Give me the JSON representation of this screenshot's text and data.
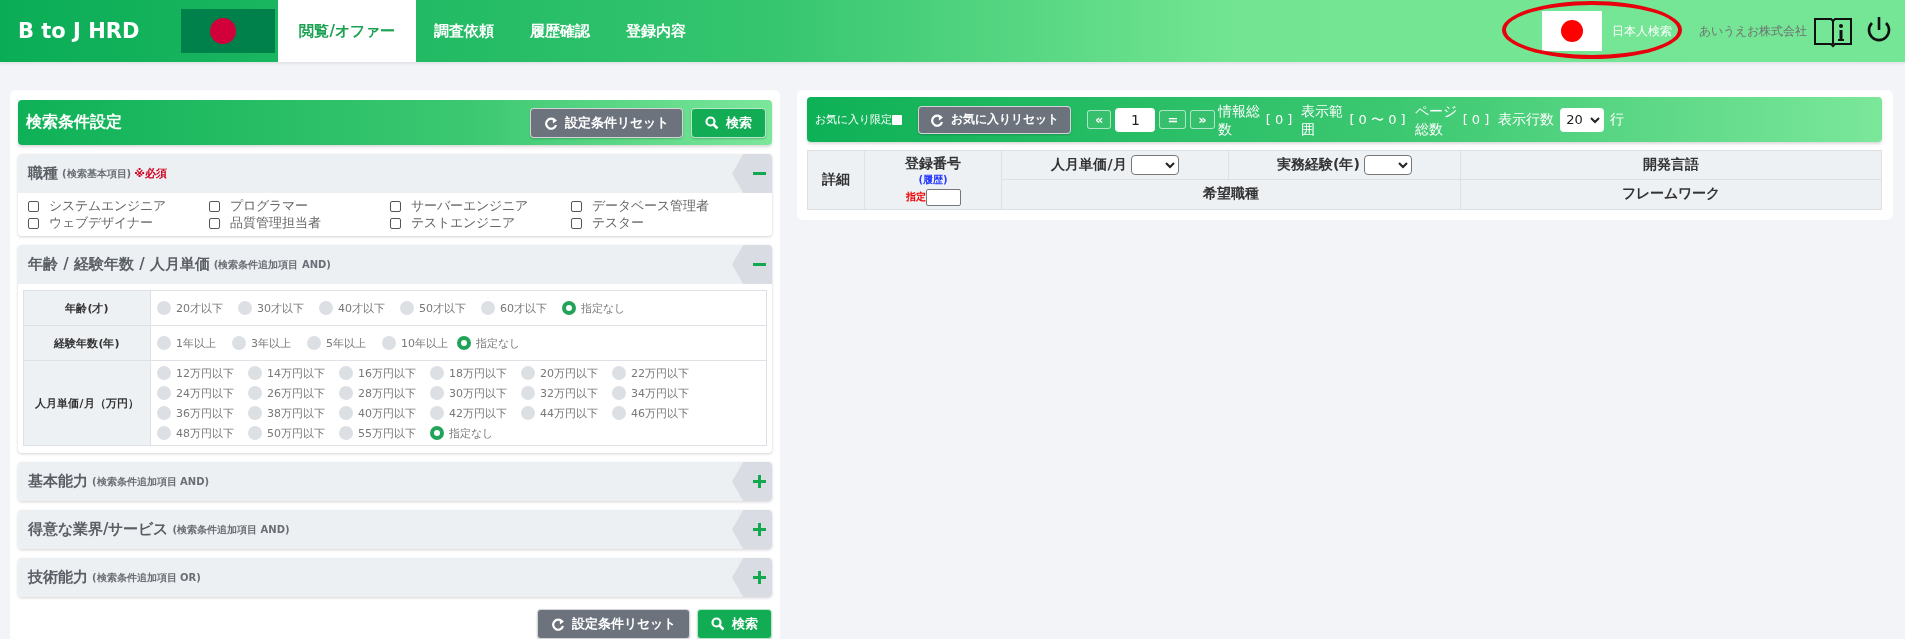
{
  "header": {
    "logo": "B to J HRD",
    "nav": [
      {
        "label": "閲覧/オファー",
        "selected": true
      },
      {
        "label": "調査依頼",
        "selected": false
      },
      {
        "label": "履歴確認",
        "selected": false
      },
      {
        "label": "登録内容",
        "selected": false
      }
    ],
    "japan_search": "日本人検索",
    "company": "あいうえお株式会社"
  },
  "search_panel": {
    "title": "検索条件設定",
    "reset_button": "設定条件リセット",
    "search_button": "検索",
    "sections": [
      {
        "kind": "checkboxes",
        "title": "職種",
        "note": "(検索基本項目)",
        "required": "※必須",
        "expanded": true,
        "options": [
          {
            "label": "システムエンジニア",
            "checked": false
          },
          {
            "label": "プログラマー",
            "checked": false
          },
          {
            "label": "サーバーエンジニア",
            "checked": false
          },
          {
            "label": "データベース管理者",
            "checked": false
          },
          {
            "label": "ウェブデザイナー",
            "checked": false
          },
          {
            "label": "品質管理担当者",
            "checked": false
          },
          {
            "label": "テストエンジニア",
            "checked": false
          },
          {
            "label": "テスター",
            "checked": false
          }
        ]
      },
      {
        "kind": "radio_table",
        "title": "年齢 / 経験年数 / 人月単価",
        "note": "(検索条件追加項目 AND)",
        "expanded": true,
        "rows": [
          {
            "label": "年齢(才)",
            "options": [
              {
                "label": "20才以下",
                "selected": false
              },
              {
                "label": "30才以下",
                "selected": false
              },
              {
                "label": "40才以下",
                "selected": false
              },
              {
                "label": "50才以下",
                "selected": false
              },
              {
                "label": "60才以下",
                "selected": false
              },
              {
                "label": "指定なし",
                "selected": true
              }
            ]
          },
          {
            "label": "経験年数(年)",
            "options": [
              {
                "label": "1年以上",
                "selected": false
              },
              {
                "label": "3年以上",
                "selected": false
              },
              {
                "label": "5年以上",
                "selected": false
              },
              {
                "label": "10年以上",
                "selected": false
              },
              {
                "label": "指定なし",
                "selected": true
              }
            ]
          },
          {
            "label": "人月単価/月（万円）",
            "options": [
              {
                "label": "12万円以下",
                "selected": false
              },
              {
                "label": "14万円以下",
                "selected": false
              },
              {
                "label": "16万円以下",
                "selected": false
              },
              {
                "label": "18万円以下",
                "selected": false
              },
              {
                "label": "20万円以下",
                "selected": false
              },
              {
                "label": "22万円以下",
                "selected": false
              },
              {
                "label": "24万円以下",
                "selected": false
              },
              {
                "label": "26万円以下",
                "selected": false
              },
              {
                "label": "28万円以下",
                "selected": false
              },
              {
                "label": "30万円以下",
                "selected": false
              },
              {
                "label": "32万円以下",
                "selected": false
              },
              {
                "label": "34万円以下",
                "selected": false
              },
              {
                "label": "36万円以下",
                "selected": false
              },
              {
                "label": "38万円以下",
                "selected": false
              },
              {
                "label": "40万円以下",
                "selected": false
              },
              {
                "label": "42万円以下",
                "selected": false
              },
              {
                "label": "44万円以下",
                "selected": false
              },
              {
                "label": "46万円以下",
                "selected": false
              },
              {
                "label": "48万円以下",
                "selected": false
              },
              {
                "label": "50万円以下",
                "selected": false
              },
              {
                "label": "55万円以下",
                "selected": false
              },
              {
                "label": "指定なし",
                "selected": true
              }
            ]
          }
        ]
      },
      {
        "title": "基本能力",
        "note": "(検索条件追加項目 AND)",
        "expanded": false
      },
      {
        "title": "得意な業界/サービス",
        "note": "(検索条件追加項目 AND)",
        "expanded": false
      },
      {
        "title": "技術能力",
        "note": "(検索条件追加項目 OR)",
        "expanded": false
      }
    ],
    "bottom_reset_button": "設定条件リセット",
    "bottom_search_button": "検索"
  },
  "results_panel": {
    "favorites_only": {
      "label": "お気に入り限定",
      "checked": false
    },
    "favorites_reset_button": "お気に入りリセット",
    "pager": {
      "first": "«",
      "page": "1",
      "go": "=",
      "next": "»"
    },
    "stats": [
      {
        "label": "情報総数",
        "value": "[ 0 ]"
      },
      {
        "label": "表示範囲",
        "value": "[ 0 〜 0 ]"
      },
      {
        "label": "ページ総数",
        "value": "[ 0 ]"
      }
    ],
    "rows_per_page": {
      "label": "表示行数",
      "value": "20",
      "unit": "行"
    },
    "table": {
      "detail": "詳細",
      "reg_no": {
        "label": "登録番号",
        "history_link": "(履歴)",
        "filter_label": "指定"
      },
      "unit_price": "人月単価/月",
      "experience": "実務経験(年)",
      "languages": "開発言語",
      "desired_job": "希望職種",
      "framework": "フレームワーク"
    }
  }
}
